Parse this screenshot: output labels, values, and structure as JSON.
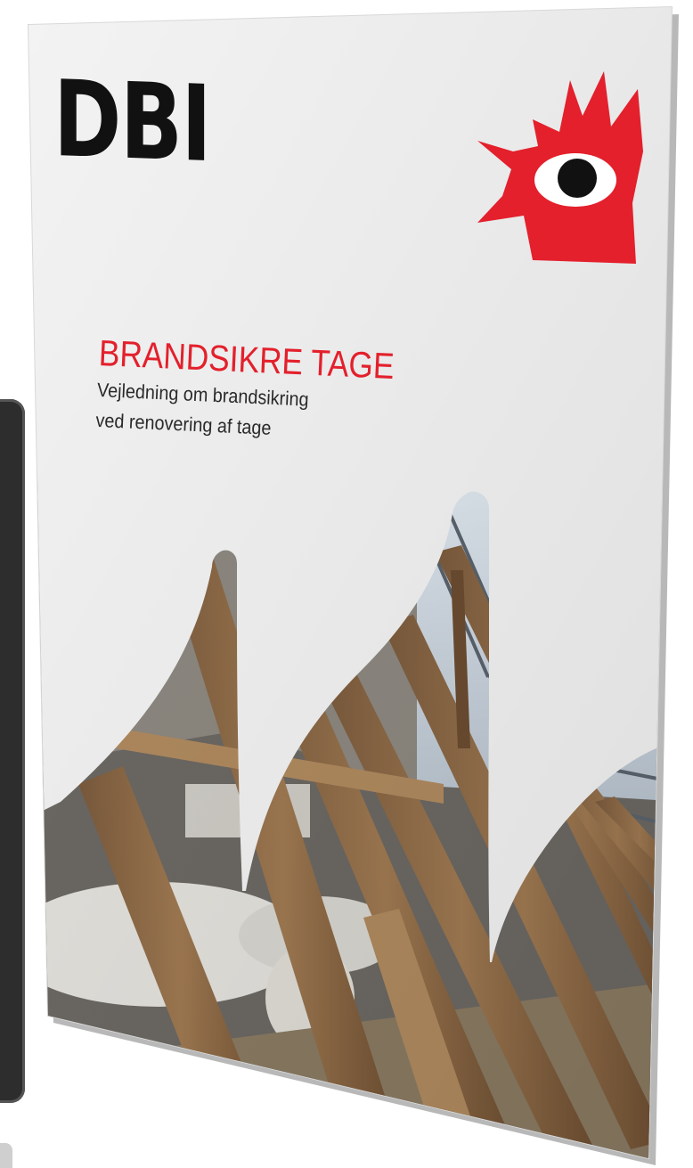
{
  "brochure": {
    "logo_text": "DBI",
    "title": "BRANDSIKRE TAGE",
    "subtitle_line1": "Vejledning om brandsikring",
    "subtitle_line2": "ved renovering af tage"
  },
  "colors": {
    "brand_red": "#e3202c",
    "logo_black": "#111111",
    "paper": "#f3f3f3"
  },
  "icons": [
    "dbi-flame-eye-logo"
  ]
}
